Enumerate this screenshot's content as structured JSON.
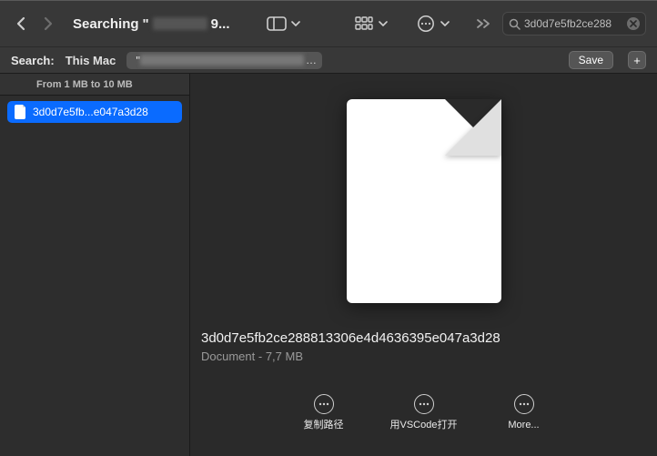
{
  "toolbar": {
    "title_prefix": "Searching",
    "title_suffix": "9...",
    "search_value": "3d0d7e5fb2ce288"
  },
  "scope": {
    "label": "Search:",
    "option_this_mac": "This Mac",
    "save_label": "Save"
  },
  "sidebar": {
    "header": "From 1 MB to 10 MB",
    "item": "3d0d7e5fb...e047a3d28"
  },
  "preview": {
    "filename": "3d0d7e5fb2ce288813306e4d4636395e047a3d28",
    "kind": "Document",
    "size": "7,7 MB"
  },
  "actions": {
    "copy_path": "复制路径",
    "open_vscode": "用VSCode打开",
    "more": "More..."
  }
}
